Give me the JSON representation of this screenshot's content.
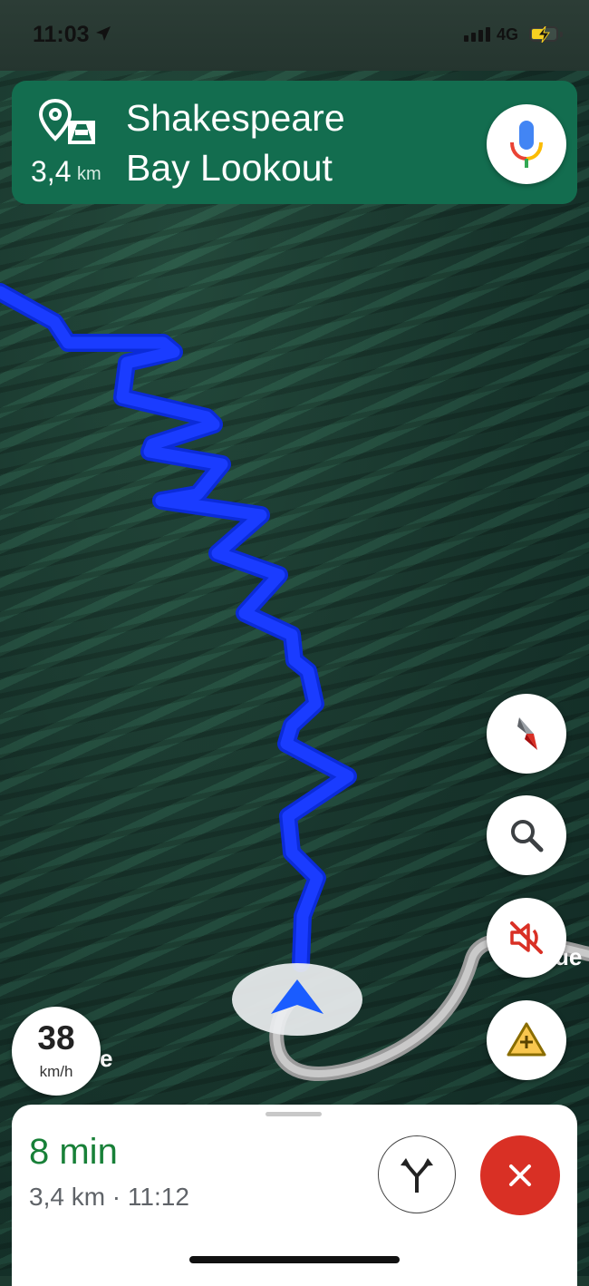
{
  "status_bar": {
    "time": "11:03",
    "network": "4G",
    "location_icon": "location-arrow-icon",
    "signal_icon": "cellular-signal-icon",
    "battery_icon": "battery-charging-icon"
  },
  "navigation": {
    "destination_line1": "Shakespeare",
    "destination_line2": "Bay Lookout",
    "distance_value": "3,4",
    "distance_unit": "km",
    "destination_icon": "destination-parking-icon",
    "voice_icon": "microphone-icon",
    "banner_color": "#136d4f"
  },
  "map": {
    "route_color": "#1a3cff",
    "side_road_label_right": "ue",
    "side_road_label_left": "e",
    "view": "satellite"
  },
  "controls": {
    "compass_icon": "compass-icon",
    "search_icon": "search-icon",
    "mute_icon": "sound-muted-icon",
    "report_icon": "add-incident-icon"
  },
  "speedometer": {
    "value": "38",
    "unit": "km/h"
  },
  "trip": {
    "eta_duration": "8 min",
    "details": "3,4 km · 11:12",
    "eta_color": "#188038",
    "routes_icon": "alternate-routes-icon",
    "exit_icon": "close-icon",
    "exit_color": "#d93025"
  }
}
